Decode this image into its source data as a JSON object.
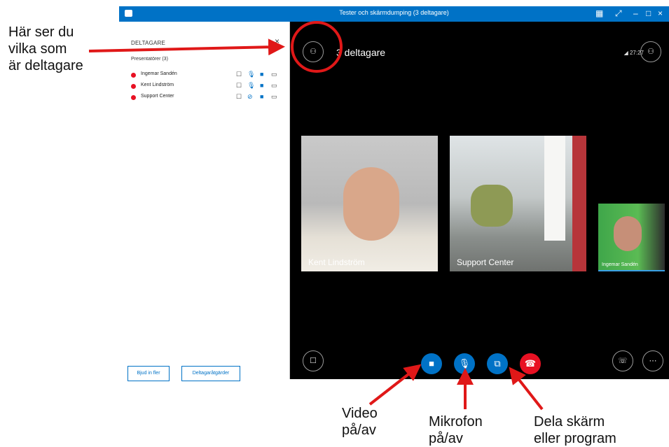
{
  "annotations": {
    "participants": "Här ser du\nvilka som\när deltagare",
    "video": "Video\npå/av",
    "mic": "Mikrofon\npå/av",
    "share": "Dela skärm\neller program"
  },
  "window": {
    "title": "Tester och skärmdumping (3 deltagare)"
  },
  "panel": {
    "title": "DELTAGARE",
    "close": "×",
    "group": "Presentatörer (3)",
    "participants": [
      {
        "name": "Ingemar Sandén"
      },
      {
        "name": "Kent Lindström"
      },
      {
        "name": "Support Center"
      }
    ],
    "invite_label": "Bjud in fler",
    "actions_label": "Deltagaråtgärder"
  },
  "stage": {
    "count_label": "3 deltagare",
    "network": "27:27",
    "tiles": [
      {
        "name": "Kent Lindström"
      },
      {
        "name": "Support Center"
      },
      {
        "name": "Ingemar Sandén"
      }
    ]
  },
  "icons": {
    "participants": "people-icon",
    "chat": "chat-icon",
    "video": "video-camera-icon",
    "mic": "microphone-icon",
    "share": "share-screen-icon",
    "hangup": "hang-up-icon",
    "device": "call-controls-icon",
    "more": "more-options-icon"
  },
  "colors": {
    "brand": "#0072c6",
    "hangup": "#e81123",
    "status_busy": "#e81123",
    "annotation_red": "#e01818"
  }
}
